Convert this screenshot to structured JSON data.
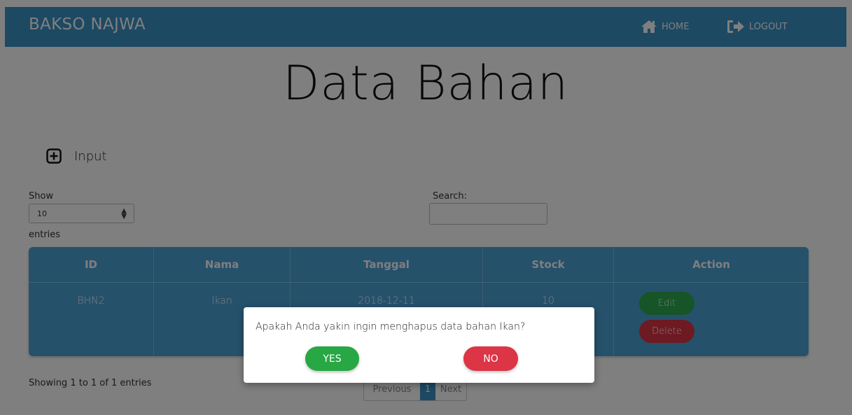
{
  "nav": {
    "brand": "BAKSO NAJWA",
    "home_label": "HOME",
    "logout_label": "LOGOUT",
    "home_icon": "home-icon",
    "logout_icon": "sign-out-icon"
  },
  "page": {
    "title": "Data Bahan",
    "input_label": "Input",
    "input_icon": "plus-square-icon"
  },
  "controls": {
    "show_label": "Show",
    "show_value": "10",
    "entries_label": "entries",
    "search_label": "Search:",
    "search_value": ""
  },
  "table": {
    "columns": [
      "ID",
      "Nama",
      "Tanggal",
      "Stock",
      "Action"
    ],
    "rows": [
      {
        "id": "BHN2",
        "nama": "Ikan",
        "tanggal": "2018-12-11",
        "stock": "10",
        "edit": "Edit",
        "delete": "Delete"
      }
    ]
  },
  "footer": {
    "info": "Showing 1 to 1 of 1 entries",
    "prev": "Previous",
    "current": "1",
    "next": "Next"
  },
  "modal": {
    "message": "Apakah Anda yakin ingin menghapus data bahan Ikan?",
    "yes_label": "YES",
    "no_label": "NO"
  },
  "colors": {
    "navbar": "#3a93c6",
    "table_header": "#4da3d7",
    "edit": "#2ea84f",
    "delete": "#dc3545",
    "yes": "#28a745",
    "no": "#dc3545"
  }
}
